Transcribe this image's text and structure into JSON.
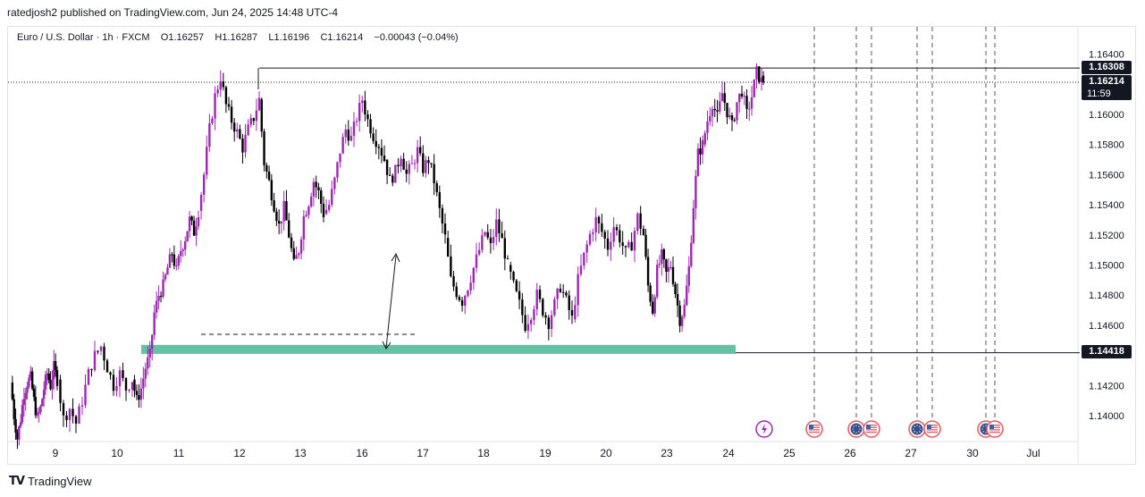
{
  "header": {
    "published_text": "ratedjosh2 published on TradingView.com, Jun 24, 2025 14:48 UTC-4"
  },
  "legend": {
    "symbol": "Euro / U.S. Dollar · 1h · FXCM",
    "open": "O1.16257",
    "high": "H1.16287",
    "low": "L1.16196",
    "close": "C1.16214",
    "change": "−0.00043 (−0.04%)"
  },
  "price_axis": {
    "ticks": [
      "1.16400",
      "1.16000",
      "1.15800",
      "1.15600",
      "1.15400",
      "1.15200",
      "1.15000",
      "1.14800",
      "1.14600",
      "1.14200",
      "1.14000"
    ],
    "tick_values": [
      1.164,
      1.16,
      1.158,
      1.156,
      1.154,
      1.152,
      1.15,
      1.148,
      1.146,
      1.142,
      1.14
    ]
  },
  "time_axis": {
    "labels": [
      "9",
      "10",
      "11",
      "12",
      "13",
      "16",
      "17",
      "18",
      "19",
      "20",
      "23",
      "24",
      "25",
      "26",
      "27",
      "30",
      "Jul"
    ]
  },
  "price_tags": {
    "high_level": "1.16308",
    "current_price": "1.16214",
    "countdown": "11:59",
    "low_level": "1.14418"
  },
  "colors": {
    "bull": "#9c27b0",
    "bear": "#000000",
    "zone": "#66c2a5",
    "axis_text": "#131722"
  },
  "event_icons": [
    "flash-icon",
    "us-flag-icon",
    "eu-flag-icon",
    "us-flag-icon",
    "eu-flag-icon",
    "us-flag-icon",
    "eu-flag-icon",
    "us-flag-icon"
  ],
  "footer": {
    "brand": "TradingView"
  },
  "chart_data": {
    "type": "candlestick",
    "title": "Euro / U.S. Dollar · 1h · FXCM",
    "ylim": [
      1.1384,
      1.1647
    ],
    "x_ticks": [
      "9",
      "10",
      "11",
      "12",
      "13",
      "16",
      "17",
      "18",
      "19",
      "20",
      "23",
      "24",
      "25",
      "26",
      "27",
      "30",
      "Jul"
    ],
    "series": [
      {
        "day": "9",
        "path": [
          1.1422,
          1.14,
          1.1385,
          1.1398,
          1.1415,
          1.1422,
          1.1425,
          1.141,
          1.1398,
          1.1405,
          1.1418,
          1.1428,
          1.142,
          1.1432,
          1.1424
        ]
      },
      {
        "day": "10",
        "path": [
          1.1424,
          1.1398,
          1.1405,
          1.1395,
          1.141,
          1.1428,
          1.144,
          1.1446,
          1.1432,
          1.142,
          1.1428,
          1.1418,
          1.1424
        ]
      },
      {
        "day": "11",
        "path": [
          1.1424,
          1.141,
          1.1418,
          1.1432,
          1.144,
          1.1468,
          1.148,
          1.1486,
          1.1498,
          1.1508,
          1.1496,
          1.151,
          1.1518,
          1.153,
          1.1522,
          1.1536
        ]
      },
      {
        "day": "12",
        "path": [
          1.1536,
          1.156,
          1.159,
          1.1612,
          1.1625,
          1.1606,
          1.1596,
          1.1588,
          1.1578,
          1.159,
          1.1598,
          1.161
        ]
      },
      {
        "day": "13",
        "path": [
          1.161,
          1.1568,
          1.1555,
          1.154,
          1.1526,
          1.1538,
          1.152,
          1.15,
          1.151,
          1.1532,
          1.1542,
          1.1556,
          1.1548,
          1.1534
        ]
      },
      {
        "day": "16",
        "path": [
          1.1534,
          1.154,
          1.1556,
          1.1576,
          1.159,
          1.1584,
          1.1598,
          1.161,
          1.1596,
          1.1586,
          1.158,
          1.157
        ]
      },
      {
        "day": "17",
        "path": [
          1.157,
          1.1556,
          1.1562,
          1.1574,
          1.156,
          1.1566,
          1.1576,
          1.1564,
          1.157,
          1.1556,
          1.1536,
          1.1518
        ]
      },
      {
        "day": "18",
        "path": [
          1.1518,
          1.149,
          1.1482,
          1.1476,
          1.1486,
          1.1498,
          1.151,
          1.1522,
          1.1512,
          1.1528,
          1.1516,
          1.15
        ]
      },
      {
        "day": "19",
        "path": [
          1.15,
          1.1486,
          1.1474,
          1.146,
          1.1468,
          1.148,
          1.147,
          1.1462,
          1.1474,
          1.1486,
          1.1476,
          1.1464
        ]
      },
      {
        "day": "20",
        "path": [
          1.1464,
          1.149,
          1.1506,
          1.152,
          1.153,
          1.1522,
          1.1512,
          1.1526,
          1.1518,
          1.1508,
          1.1514,
          1.1532,
          1.152
        ]
      },
      {
        "day": "23",
        "path": [
          1.152,
          1.1486,
          1.147,
          1.1496,
          1.1506,
          1.1494,
          1.15,
          1.1482,
          1.1464,
          1.1472,
          1.1498,
          1.154,
          1.1574,
          1.158
        ]
      },
      {
        "day": "24",
        "path": [
          1.158,
          1.1596,
          1.1608,
          1.1598,
          1.1614,
          1.1602,
          1.1592,
          1.1608,
          1.1616,
          1.16,
          1.1612,
          1.1628,
          1.1622
        ]
      }
    ],
    "last_candle": {
      "open": 1.16257,
      "high": 1.16287,
      "low": 1.16196,
      "close": 1.16214
    },
    "annotations": {
      "resistance_line": 1.16308,
      "current_price_line": 1.16214,
      "support_line": 1.14418,
      "support_zone": [
        1.1441,
        1.1447
      ],
      "dashed_level": 1.1454,
      "event_days": [
        "25",
        "26",
        "26",
        "27",
        "27",
        "30",
        "30"
      ]
    }
  }
}
